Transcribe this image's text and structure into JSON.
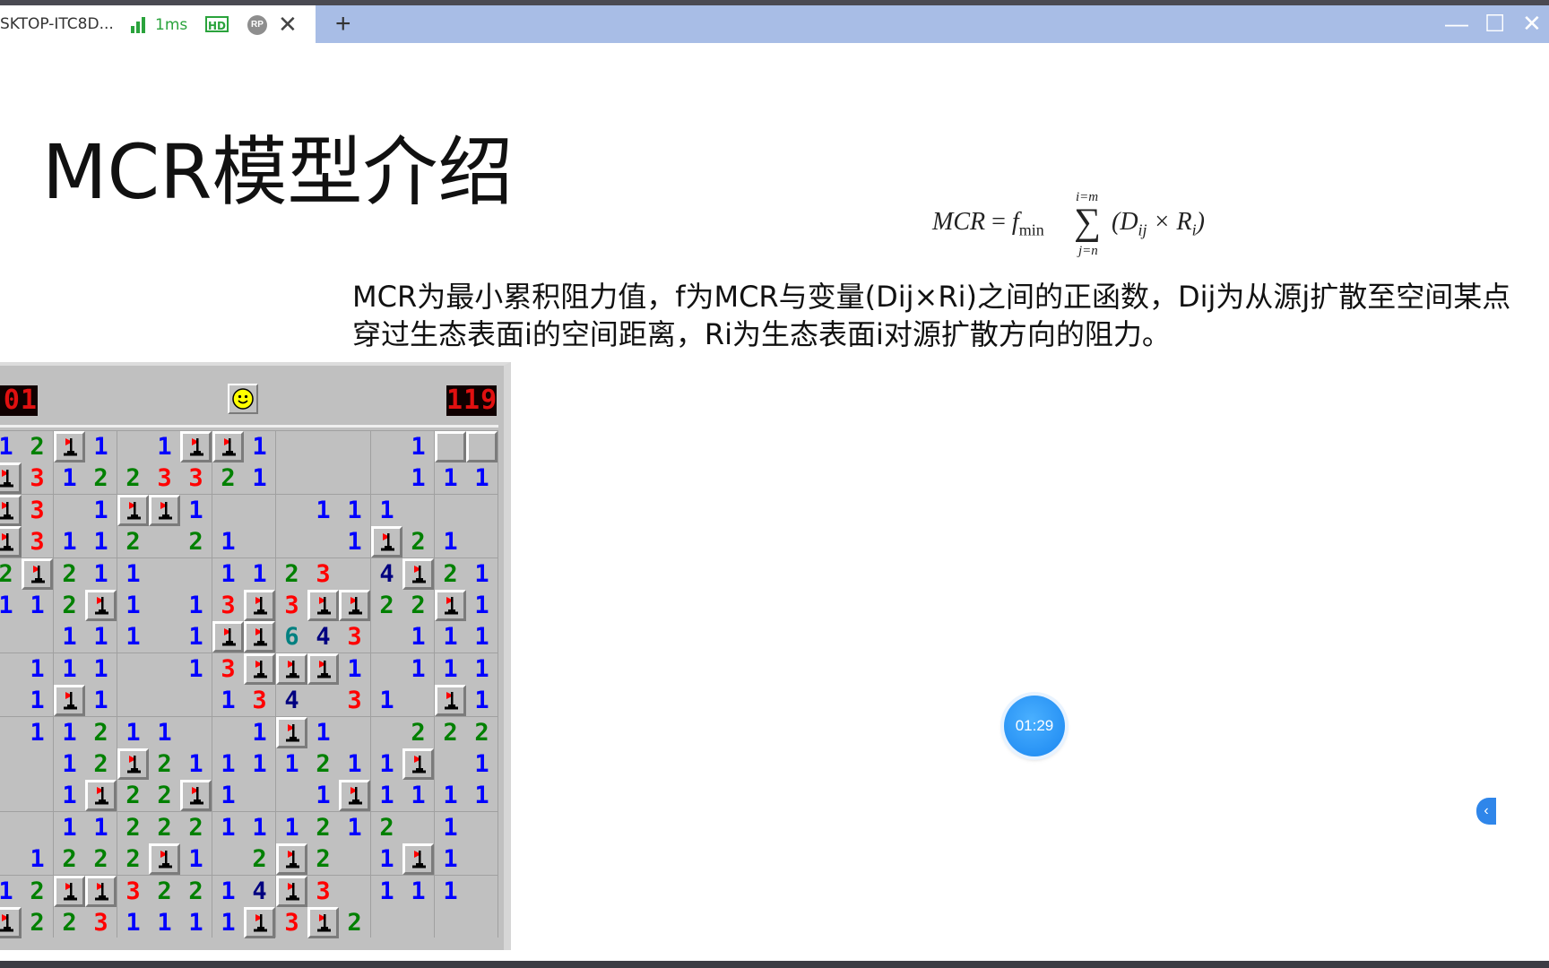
{
  "browser": {
    "tab_title": "SKTOP-ITC8D...",
    "latency": "1ms",
    "hd_badge": "HD",
    "rp_badge": "RP",
    "close_glyph": "✕",
    "new_tab_glyph": "+",
    "minimize_glyph": "—",
    "maximize_glyph": "☐",
    "window_close_glyph": "✕",
    "accent_color": "#a8bde6",
    "status_color": "#2aa33c"
  },
  "slide": {
    "title": "MCR模型介绍",
    "formula": {
      "lhs": "MCR",
      "f": "f",
      "f_sub": "min",
      "sum_upper": "i=m",
      "sum_lower": "j=n",
      "term_open": "(D",
      "term_sub1": "ij",
      "term_mid": " × R",
      "term_sub2": "i",
      "term_close": ")"
    },
    "description": "MCR为最小累积阻力值，f为MCR与变量(Dij×Ri)之间的正函数，Dij为从源j扩散至空间某点穿过生态表面i的空间距离，Ri为生态表面i对源扩散方向的阻力。"
  },
  "minesweeper": {
    "mines_left": "01",
    "time": "119",
    "face": "smiley-face-icon",
    "grid": [
      "12F1 1FF1    1##",
      "F31223321    111",
      "F3 1FF1   111   ",
      "F3112 21   1F21 ",
      "2F211  1123 4F21",
      "112F1 13F3FF22F1",
      "  111 1FF643 111",
      " 111  13FFF1 111",
      " 1F1   134 31 F1",
      " 11211  1F1  222",
      "  12F21111211F 1",
      "  1F22F1  1F1111",
      "  11222111212 1 ",
      " 1222F1 2F2 1F1 ",
      "12FF32214F3 111 ",
      "F2231111F3F2    "
    ],
    "number_colors": {
      "1": "#0000ff",
      "2": "#008000",
      "3": "#ff0000",
      "4": "#000080",
      "6": "#008080"
    }
  },
  "overlay": {
    "timer": "01:29",
    "side_toggle_glyph": "‹"
  }
}
